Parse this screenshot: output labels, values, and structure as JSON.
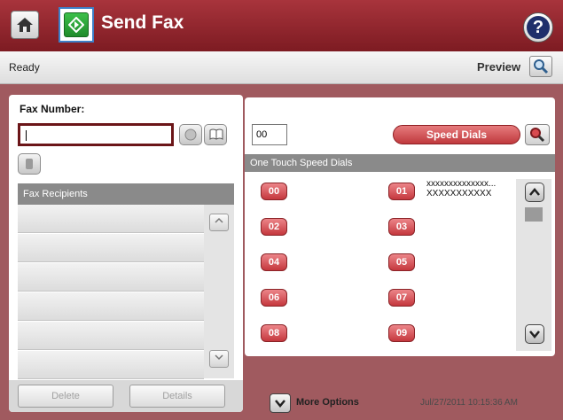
{
  "header": {
    "title": "Send Fax",
    "help_label": "?"
  },
  "status": {
    "text": "Ready",
    "preview_label": "Preview"
  },
  "left": {
    "fax_number_label": "Fax Number:",
    "fax_number_value": "",
    "recipients_header": "Fax Recipients",
    "recipient_rows": [
      "",
      "",
      "",
      "",
      "",
      ""
    ],
    "delete_label": "Delete",
    "details_label": "Details"
  },
  "right": {
    "speed_dial_input": "00",
    "speed_dials_label": "Speed Dials",
    "one_touch_header": "One Touch Speed Dials",
    "buttons": [
      "00",
      "01",
      "02",
      "03",
      "04",
      "05",
      "06",
      "07",
      "08",
      "09"
    ],
    "entry01_line1": "xxxxxxxxxxxxxx...",
    "entry01_line2": "XXXXXXXXXXX"
  },
  "footer": {
    "more_options_label": "More Options",
    "datetime": "Jul/27/2011 10:15:36 AM"
  },
  "colors": {
    "header_red": "#8e252c",
    "speed_button_red": "#c5383e",
    "start_green": "#2aa836"
  },
  "icons": [
    "home-icon",
    "start-icon",
    "help-icon",
    "magnifier-icon",
    "keypad-icon",
    "address-book-icon",
    "chevron-up-icon",
    "chevron-down-icon"
  ]
}
